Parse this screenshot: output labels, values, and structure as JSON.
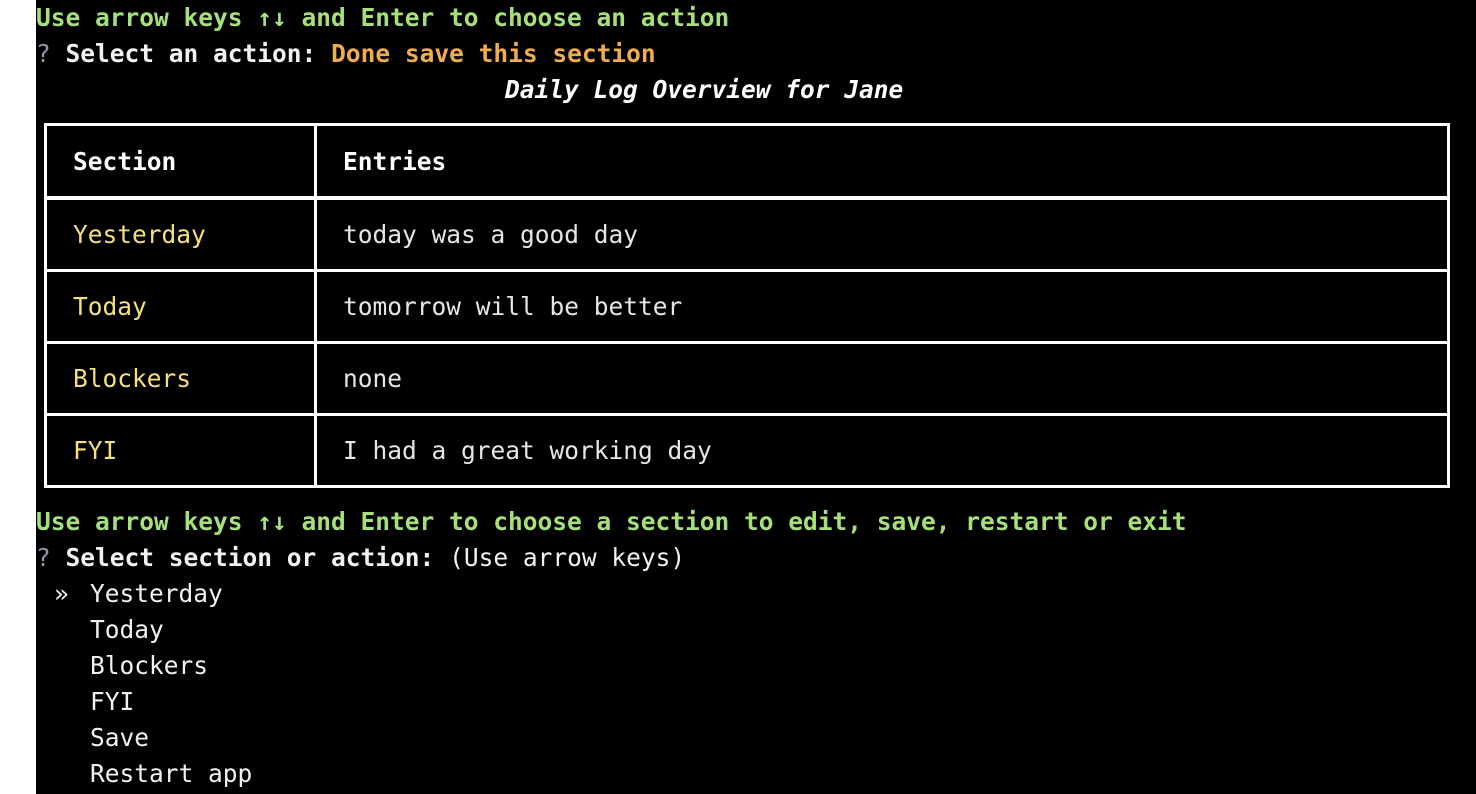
{
  "top_hint": "Use arrow keys ↑↓ and Enter to choose an action",
  "prompt1": {
    "qmark": "?",
    "label": "Select an action:",
    "answer": "Done save this section"
  },
  "table": {
    "title": "Daily Log Overview for Jane",
    "headers": [
      "Section",
      "Entries"
    ],
    "rows": [
      {
        "section": "Yesterday",
        "entry": "today was a good day"
      },
      {
        "section": "Today",
        "entry": "tomorrow will be better"
      },
      {
        "section": "Blockers",
        "entry": "none"
      },
      {
        "section": "FYI",
        "entry": "I had a great working day"
      }
    ]
  },
  "bottom_hint": "Use arrow keys ↑↓ and Enter to choose a section to edit, save, restart or exit",
  "prompt2": {
    "qmark": "?",
    "label": "Select section or action:",
    "help": "(Use arrow keys)"
  },
  "menu": {
    "pointer": "»",
    "options": [
      "Yesterday",
      "Today",
      "Blockers",
      "FYI",
      "Save",
      "Restart app"
    ]
  },
  "colors": {
    "background": "#000000",
    "hint_green": "#a6e07a",
    "answer_orange": "#f0ad4e",
    "section_yellow": "#f5e07a"
  }
}
